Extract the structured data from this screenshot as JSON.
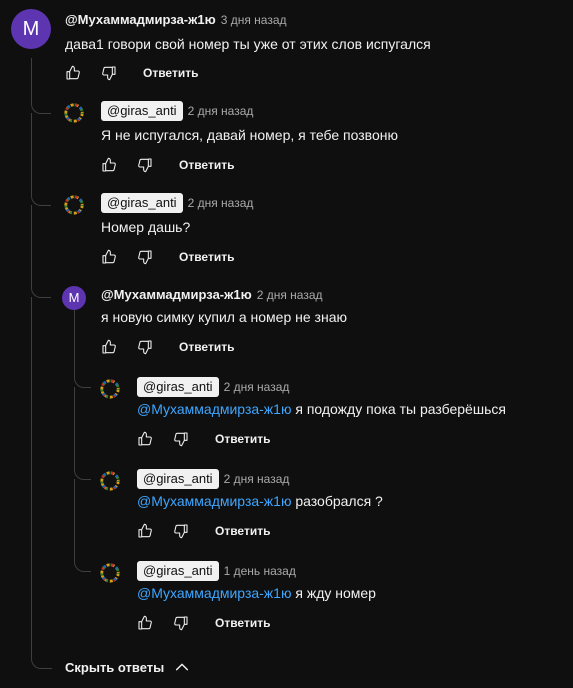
{
  "comments": [
    {
      "author": "@Мухаммадмирза-ж1ю",
      "avatar_letter": "M",
      "time": "3 дня назад",
      "text": "дава1 говори свой номер ты уже от этих слов испугался",
      "reply_label": "Ответить"
    },
    {
      "author": "@giras_anti",
      "time": "2 дня назад",
      "text": "Я не испугался, давай номер, я тебе позвоню",
      "reply_label": "Ответить"
    },
    {
      "author": "@giras_anti",
      "time": "2 дня назад",
      "text": "Номер дашь?",
      "reply_label": "Ответить"
    },
    {
      "author": "@Мухаммадмирза-ж1ю",
      "avatar_letter": "M",
      "time": "2 дня назад",
      "text": "я новую симку купил а номер не знаю",
      "reply_label": "Ответить"
    },
    {
      "author": "@giras_anti",
      "time": "2 дня назад",
      "mention": "@Мухаммадмирза-ж1ю",
      "text": " я подожду пока ты разберёшься",
      "reply_label": "Ответить"
    },
    {
      "author": "@giras_anti",
      "time": "2 дня назад",
      "mention": "@Мухаммадмирза-ж1ю",
      "text": " разобрался ?",
      "reply_label": "Ответить"
    },
    {
      "author": "@giras_anti",
      "time": "1 день назад",
      "mention": "@Мухаммадмирза-ж1ю",
      "text": " я жду номер",
      "reply_label": "Ответить"
    }
  ],
  "hide_replies_label": "Скрыть ответы",
  "colors": {
    "background": "#0f0f0f",
    "mention": "#3ea6ff",
    "avatar_purple": "#5e35b1",
    "thread_line": "#3f3f3f"
  }
}
